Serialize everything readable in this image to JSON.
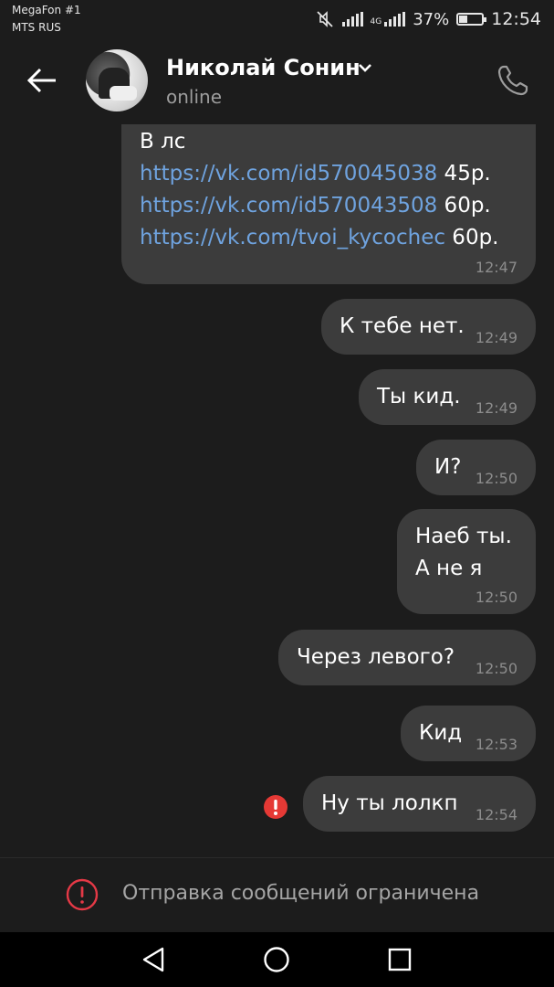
{
  "status_bar": {
    "carrier_1": "MegaFon #1",
    "carrier_2": "MTS RUS",
    "network": "4G",
    "battery": "37%",
    "battery_level": 0.37,
    "time": "12:54"
  },
  "header": {
    "contact_name": "Николай Сонин",
    "status": "online"
  },
  "messages": [
    {
      "lines": [
        {
          "text": "В лс",
          "suffix": ""
        },
        {
          "text": "https://vk.com/id570045038",
          "suffix": " 45р."
        },
        {
          "text": "https://vk.com/id570043508",
          "suffix": " 60р."
        },
        {
          "text": "https://vk.com/tvoi_kycochec",
          "suffix": " 60р."
        }
      ],
      "time": "12:47"
    },
    {
      "text": "К тебе нет.",
      "time": "12:49"
    },
    {
      "text": "Ты кид.",
      "time": "12:49"
    },
    {
      "text": "И?",
      "time": "12:50"
    },
    {
      "line1": "Наеб ты.",
      "line2": "А не я",
      "time": "12:50"
    },
    {
      "text": "Через левого?",
      "time": "12:50"
    },
    {
      "text": "Кид",
      "time": "12:53"
    },
    {
      "text": "Ну ты лолкп",
      "time": "12:54",
      "failed": true
    }
  ],
  "restriction": {
    "text": "Отправка сообщений ограничена"
  },
  "colors": {
    "background": "#1c1c1c",
    "bubble": "#3c3c3c",
    "link": "#6fa3df",
    "error": "#e53935"
  },
  "icons": [
    "back-arrow-icon",
    "chevron-down-icon",
    "phone-icon",
    "error-icon",
    "nav-back-icon",
    "nav-home-icon",
    "nav-recents-icon"
  ]
}
